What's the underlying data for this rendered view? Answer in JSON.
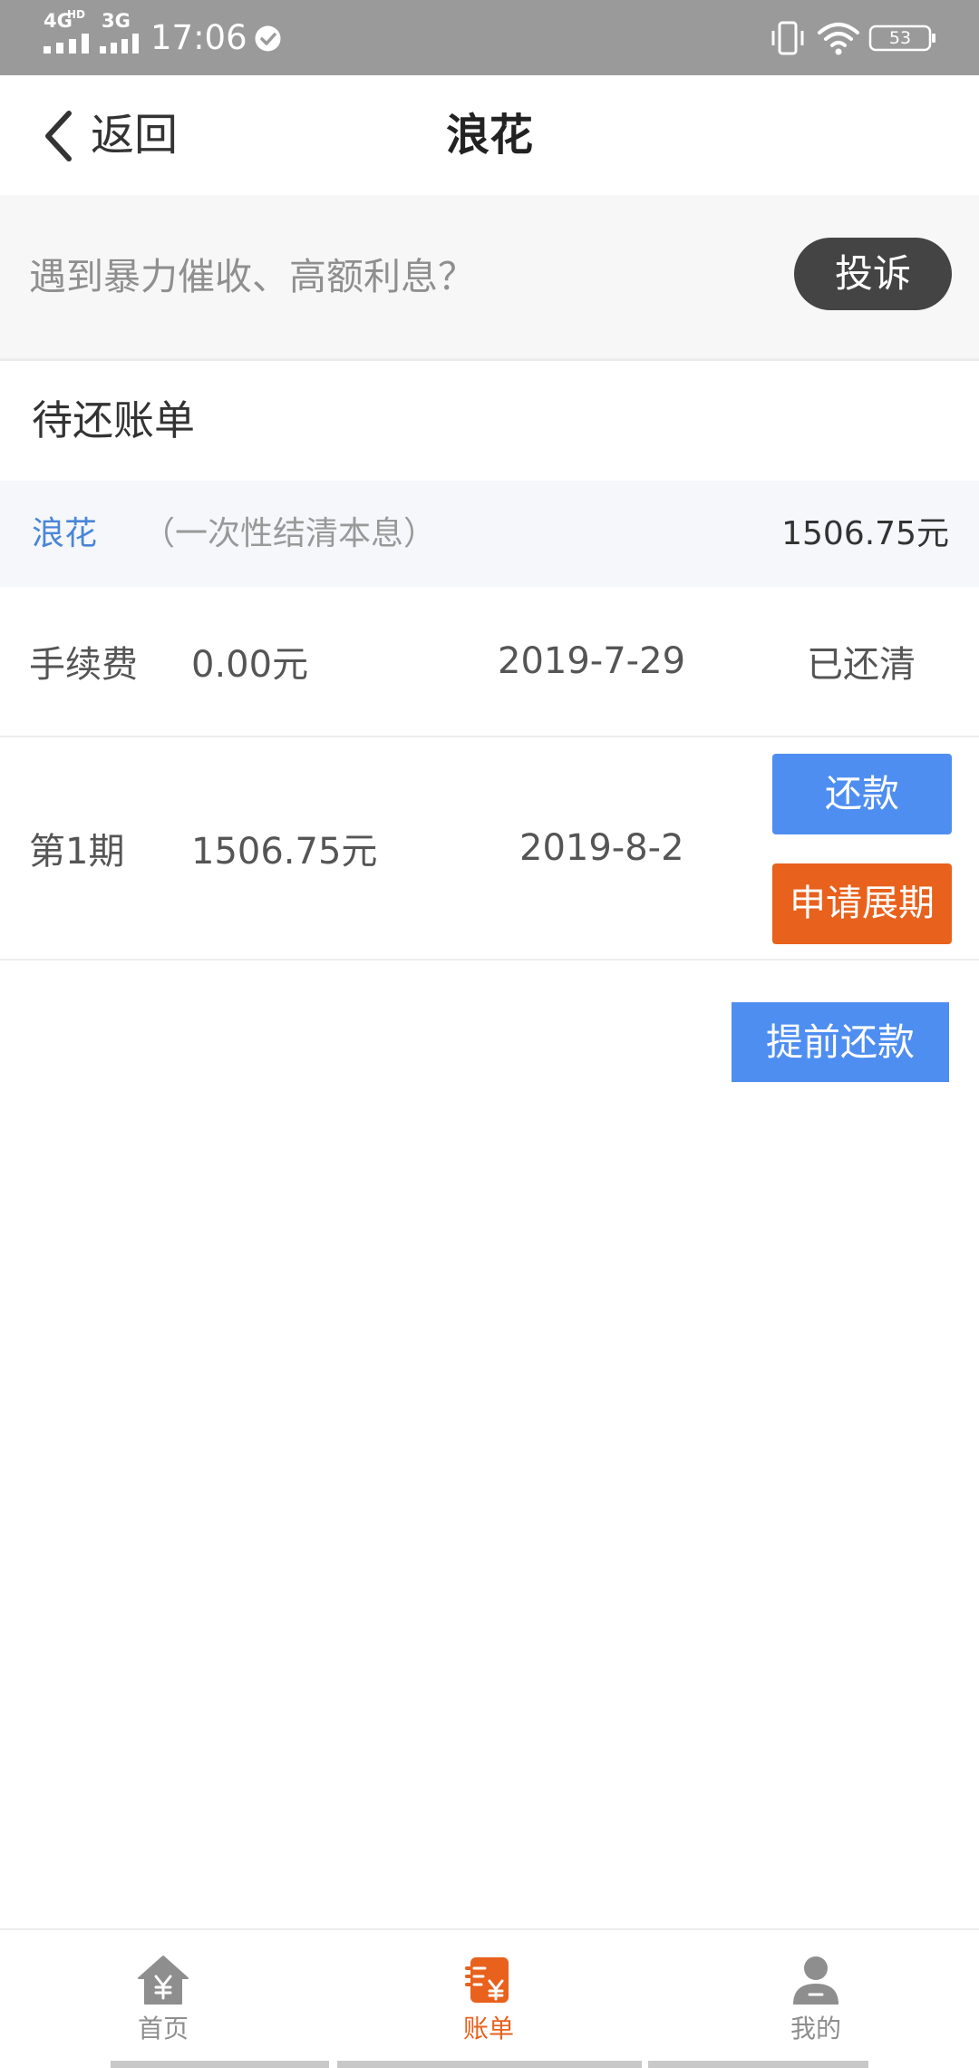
{
  "status_bar": {
    "network_1": "4G",
    "network_1_badge": "HD",
    "network_2": "3G",
    "time": "17:06",
    "battery_level": "53",
    "icons": [
      "signal-icon",
      "check-circle-icon",
      "vibrate-icon",
      "wifi-icon",
      "battery-icon"
    ]
  },
  "header": {
    "back_icon": "chevron-left-icon",
    "back_label": "返回",
    "title": "浪花"
  },
  "complaint_banner": {
    "text": "遇到暴力催收、高额利息？",
    "button_label": "投诉"
  },
  "bills": {
    "section_title": "待还账单",
    "product": {
      "name": "浪花",
      "repayment_note": "（一次性结清本息）",
      "total": "1506.75元"
    },
    "rows": [
      {
        "label": "手续费",
        "amount": "0.00元",
        "due_date": "2019-7-29",
        "status": "已还清"
      },
      {
        "label": "第1期",
        "amount": "1506.75元",
        "due_date": "2019-8-2",
        "actions": {
          "repay": "还款",
          "extend": "申请展期"
        }
      }
    ],
    "prepay_label": "提前还款"
  },
  "bottom_nav": {
    "items": [
      {
        "label": "首页",
        "icon": "home-yen-icon",
        "active": false
      },
      {
        "label": "账单",
        "icon": "bill-yen-icon",
        "active": true
      },
      {
        "label": "我的",
        "icon": "person-icon",
        "active": false
      }
    ]
  },
  "colors": {
    "status_bar_bg": "#9a9a9a",
    "primary_blue": "#4f8ef1",
    "accent_orange": "#e8611d",
    "link_blue": "#4a86d6",
    "complaint_button_bg": "#444444",
    "nav_inactive": "#8e8e8e"
  }
}
